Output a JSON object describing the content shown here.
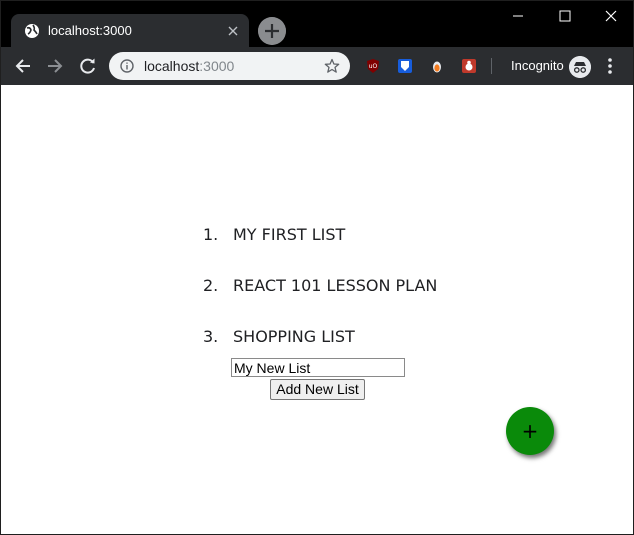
{
  "browser": {
    "tab_title": "localhost:3000",
    "url_host": "localhost",
    "url_port": ":3000",
    "incognito_label": "Incognito",
    "icons": [
      "globe-icon",
      "close-icon",
      "new-tab-icon",
      "minimize-icon",
      "maximize-icon",
      "window-close-icon",
      "back-icon",
      "forward-icon",
      "reload-icon",
      "info-icon",
      "star-icon",
      "ublock-icon",
      "bitwarden-icon",
      "extension-drop-icon",
      "extension-bug-icon",
      "incognito-icon",
      "menu-icon"
    ]
  },
  "page": {
    "lists": [
      {
        "number": "1.",
        "title": "MY FIRST LIST"
      },
      {
        "number": "2.",
        "title": "REACT 101 LESSON PLAN"
      },
      {
        "number": "3.",
        "title": "SHOPPING LIST"
      }
    ],
    "new_list_input_value": "My New List",
    "add_button_label": "Add New List",
    "fab_label": "+",
    "fab_color": "#0a8a0a"
  }
}
